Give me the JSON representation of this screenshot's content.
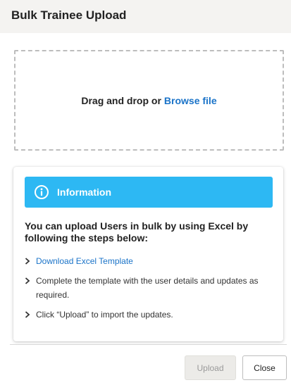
{
  "dialog": {
    "title": "Bulk Trainee Upload"
  },
  "dropzone": {
    "prompt": "Drag and drop or",
    "browse_link": "Browse file"
  },
  "info": {
    "icon": "info-icon",
    "heading": "Information",
    "accent_color": "#2db8f3",
    "lead": "You can upload Users in bulk by using Excel by following the steps below:",
    "steps": [
      {
        "text": "Download Excel Template",
        "is_link": true
      },
      {
        "text": "Complete the template with the user details and updates as required.",
        "is_link": false
      },
      {
        "text": "Click “Upload” to import the updates.",
        "is_link": false
      }
    ]
  },
  "footer": {
    "upload_label": "Upload",
    "upload_disabled": true,
    "close_label": "Close"
  }
}
